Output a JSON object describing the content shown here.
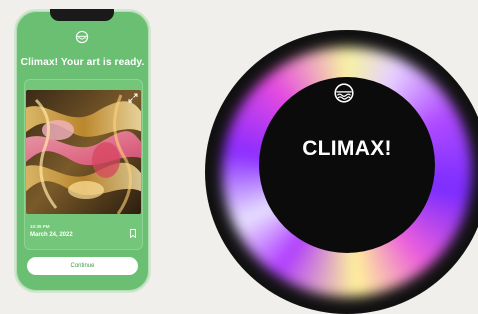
{
  "phone": {
    "headline": "Climax! Your art is ready.",
    "card": {
      "time": "10:35 PM",
      "date": "March 24, 2022",
      "expand_icon": "expand-icon",
      "bookmark_icon": "bookmark-icon"
    },
    "continue_label": "Continue",
    "logo_icon": "globe-wave-logo-icon"
  },
  "orb": {
    "title": "CLIMAX!",
    "logo_icon": "globe-wave-logo-icon"
  },
  "colors": {
    "background": "#f1efec",
    "phone_green": "#6bbf72",
    "button_text": "#3f9a49",
    "orb_purple": "#8b2cff",
    "orb_yellow": "#fff39a"
  }
}
